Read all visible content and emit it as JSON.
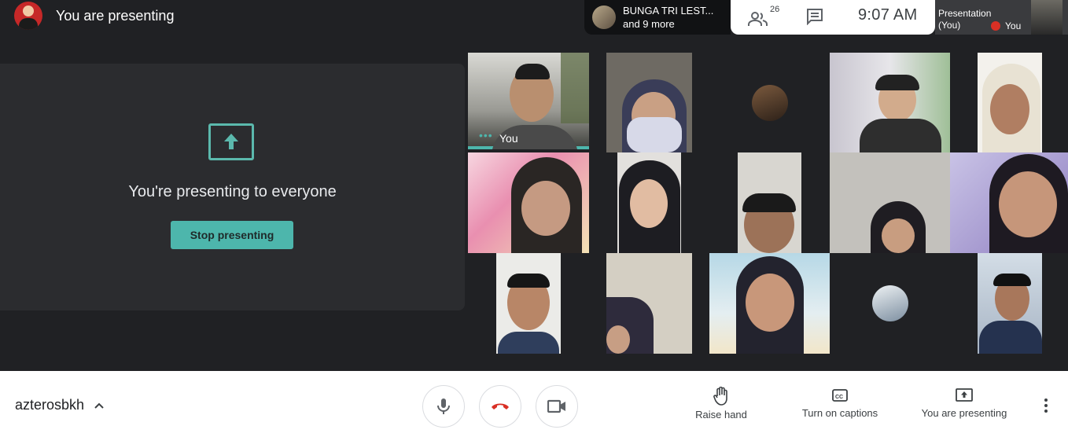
{
  "header": {
    "title": "You are presenting",
    "user_avatar_icon": "user-avatar"
  },
  "top_bar": {
    "participant_name": "BUNGA TRI LEST...",
    "participant_more": "and 9 more",
    "people_count": "26",
    "people_icon": "people-icon",
    "chat_icon": "chat-icon",
    "time": "9:07  AM",
    "presentation_label": "Presentation",
    "presentation_owner": "(You)",
    "presentation_you": "You"
  },
  "present_card": {
    "message": "You're presenting to everyone",
    "stop_button": "Stop presenting",
    "accent": "#4db6ac"
  },
  "tiles": {
    "self_name": "You"
  },
  "bottom_bar": {
    "meeting_code": "azterosbkh",
    "raise_hand": "Raise hand",
    "captions": "Turn on captions",
    "presenting": "You are presenting",
    "end_call_color": "#d93025"
  }
}
